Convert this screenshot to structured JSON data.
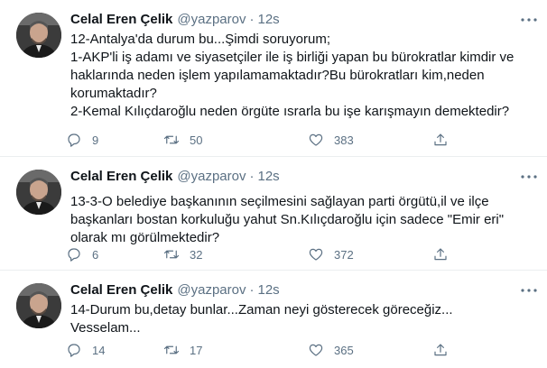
{
  "tweets": [
    {
      "author": "Celal Eren Çelik",
      "handle": "@yazparov",
      "separator": "·",
      "time": "12s",
      "text": "12-Antalya'da durum bu...Şimdi soruyorum;\n1-AKP'li iş adamı ve siyasetçiler ile iş birliği yapan bu bürokratlar kimdir ve haklarında neden işlem yapılamamaktadır?Bu bürokratları kim,neden korumaktadır?\n2-Kemal Kılıçdaroğlu neden örgüte ısrarla bu işe karışmayın demektedir?",
      "replies": "9",
      "retweets": "50",
      "likes": "383"
    },
    {
      "author": "Celal Eren Çelik",
      "handle": "@yazparov",
      "separator": "·",
      "time": "12s",
      "text": "13-3-O belediye başkanının seçilmesini sağlayan parti örgütü,il ve ilçe başkanları bostan korkuluğu yahut Sn.Kılıçdaroğlu için sadece \"Emir eri\" olarak mı görülmektedir?",
      "replies": "6",
      "retweets": "32",
      "likes": "372"
    },
    {
      "author": "Celal Eren Çelik",
      "handle": "@yazparov",
      "separator": "·",
      "time": "12s",
      "text": "14-Durum bu,detay bunlar...Zaman neyi gösterecek göreceğiz...\nVesselam...",
      "replies": "14",
      "retweets": "17",
      "likes": "365"
    }
  ],
  "icons": {
    "more": "more-dots-icon",
    "reply": "reply-icon",
    "retweet": "retweet-icon",
    "like": "heart-icon",
    "share": "share-icon"
  },
  "colors": {
    "secondary_text": "#5b7083",
    "divider": "#ebeef0",
    "primary_text": "#0f1419"
  }
}
